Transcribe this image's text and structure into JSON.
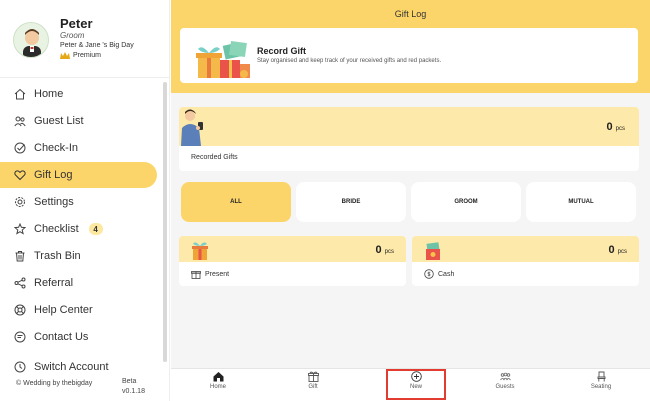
{
  "profile": {
    "name": "Peter",
    "role": "Groom",
    "event": "Peter & Jane 's Big Day",
    "tier": "Premium"
  },
  "nav": {
    "items": [
      {
        "label": "Home",
        "icon": "home-icon"
      },
      {
        "label": "Guest List",
        "icon": "people-icon"
      },
      {
        "label": "Check-In",
        "icon": "check-circle-icon"
      },
      {
        "label": "Gift Log",
        "icon": "heart-icon",
        "active": true
      },
      {
        "label": "Settings",
        "icon": "gear-icon"
      },
      {
        "label": "Checklist",
        "icon": "star-icon",
        "badge": "4"
      },
      {
        "label": "Trash Bin",
        "icon": "trash-icon"
      },
      {
        "label": "Referral",
        "icon": "share-icon"
      },
      {
        "label": "Help Center",
        "icon": "help-icon"
      },
      {
        "label": "Contact Us",
        "icon": "contact-icon"
      },
      {
        "label": "Switch Account",
        "icon": "switch-icon"
      }
    ]
  },
  "footer": {
    "copyright": "© Wedding by thebigday",
    "beta": "Beta",
    "version": "v0.1.18"
  },
  "header": {
    "title": "Gift Log"
  },
  "record": {
    "title": "Record Gift",
    "description": "Stay organised and keep track of your received gifts and red packets."
  },
  "recorded": {
    "count": "0",
    "unit": "pcs",
    "label": "Recorded Gifts"
  },
  "filters": {
    "tabs": [
      {
        "label": "ALL",
        "active": true
      },
      {
        "label": "BRIDE"
      },
      {
        "label": "GROOM"
      },
      {
        "label": "MUTUAL"
      }
    ]
  },
  "present": {
    "count": "0",
    "unit": "pcs",
    "label": "Present"
  },
  "cash": {
    "count": "0",
    "unit": "pcs",
    "label": "Cash"
  },
  "bottom_nav": {
    "items": [
      {
        "label": "Home",
        "icon": "home-icon"
      },
      {
        "label": "Gift",
        "icon": "gift-icon"
      },
      {
        "label": "New",
        "icon": "plus-circle-icon"
      },
      {
        "label": "Guests",
        "icon": "guests-icon"
      },
      {
        "label": "Seating",
        "icon": "chair-icon"
      }
    ]
  },
  "colors": {
    "accent": "#fcd56a",
    "accent_light": "#fde9a9",
    "highlight": "#e23b2f"
  }
}
